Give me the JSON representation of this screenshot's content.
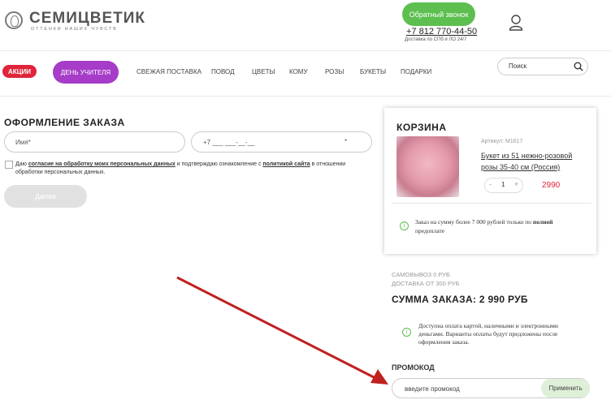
{
  "header": {
    "brand": "СЕМИЦВЕТИК",
    "tagline": "ОТТЕНКИ НАШИХ ЧУВСТВ",
    "callback_label": "Обратный звонок",
    "phone": "+7 812 770-44-50",
    "delivery_text": "Доставка по СПб и ЛО 24/7"
  },
  "nav": {
    "promo_badge": "АКЦИИ",
    "teacher_day": "ДЕНЬ УЧИТЕЛЯ",
    "items": [
      "СВЕЖАЯ ПОСТАВКА",
      "ПОВОД",
      "ЦВЕТЫ",
      "КОМУ",
      "РОЗЫ",
      "БУКЕТЫ",
      "ПОДАРКИ"
    ],
    "search_placeholder": "Поиск"
  },
  "order": {
    "title": "ОФОРМЛЕНИЕ ЗАКАЗА",
    "name_placeholder": "Имя*",
    "phone_placeholder": "+7 ___ ___-__-__",
    "phone_required": "*",
    "consent_prefix": "Даю",
    "consent_link1": "согласие на обработку моих персональных данных",
    "consent_mid": "и подтверждаю ознакомление с",
    "consent_link2": "политикой сайта",
    "consent_suffix": "в отношении обработки персональных данных.",
    "next_button": "Далее"
  },
  "cart": {
    "title": "КОРЗИНА",
    "sku": "Артикул: М1617",
    "product_name": "Букет из 51 нежно-розовой розы 35-40 см (Россия)",
    "quantity": "1",
    "minus": "-",
    "plus": "+",
    "price": "2990",
    "note_prefix": "Заказ на сумму более 7 000 рублей только по",
    "note_bold": "полной",
    "note_suffix": "предоплате"
  },
  "summary": {
    "pickup": "САМОВЫВОЗ 0 РУБ",
    "delivery": "ДОСТАВКА ОТ 300 РУБ",
    "total": "СУММА ЗАКАЗА: 2 990 РУБ",
    "payment_note": "Доступна оплата картой, наличными и электронными деньгами. Варианты оплаты будут предложены после оформления заказа."
  },
  "promo": {
    "title": "ПРОМОКОД",
    "placeholder": "введите промокод",
    "apply_button": "Применить"
  },
  "colors": {
    "green": "#5cbf4f",
    "red": "#e0243b",
    "purple": "#a63cc8",
    "arrow": "#c0201f"
  },
  "icons": [
    "logo-icon",
    "user-icon",
    "search-icon",
    "info-icon",
    "arrow-annotation"
  ]
}
